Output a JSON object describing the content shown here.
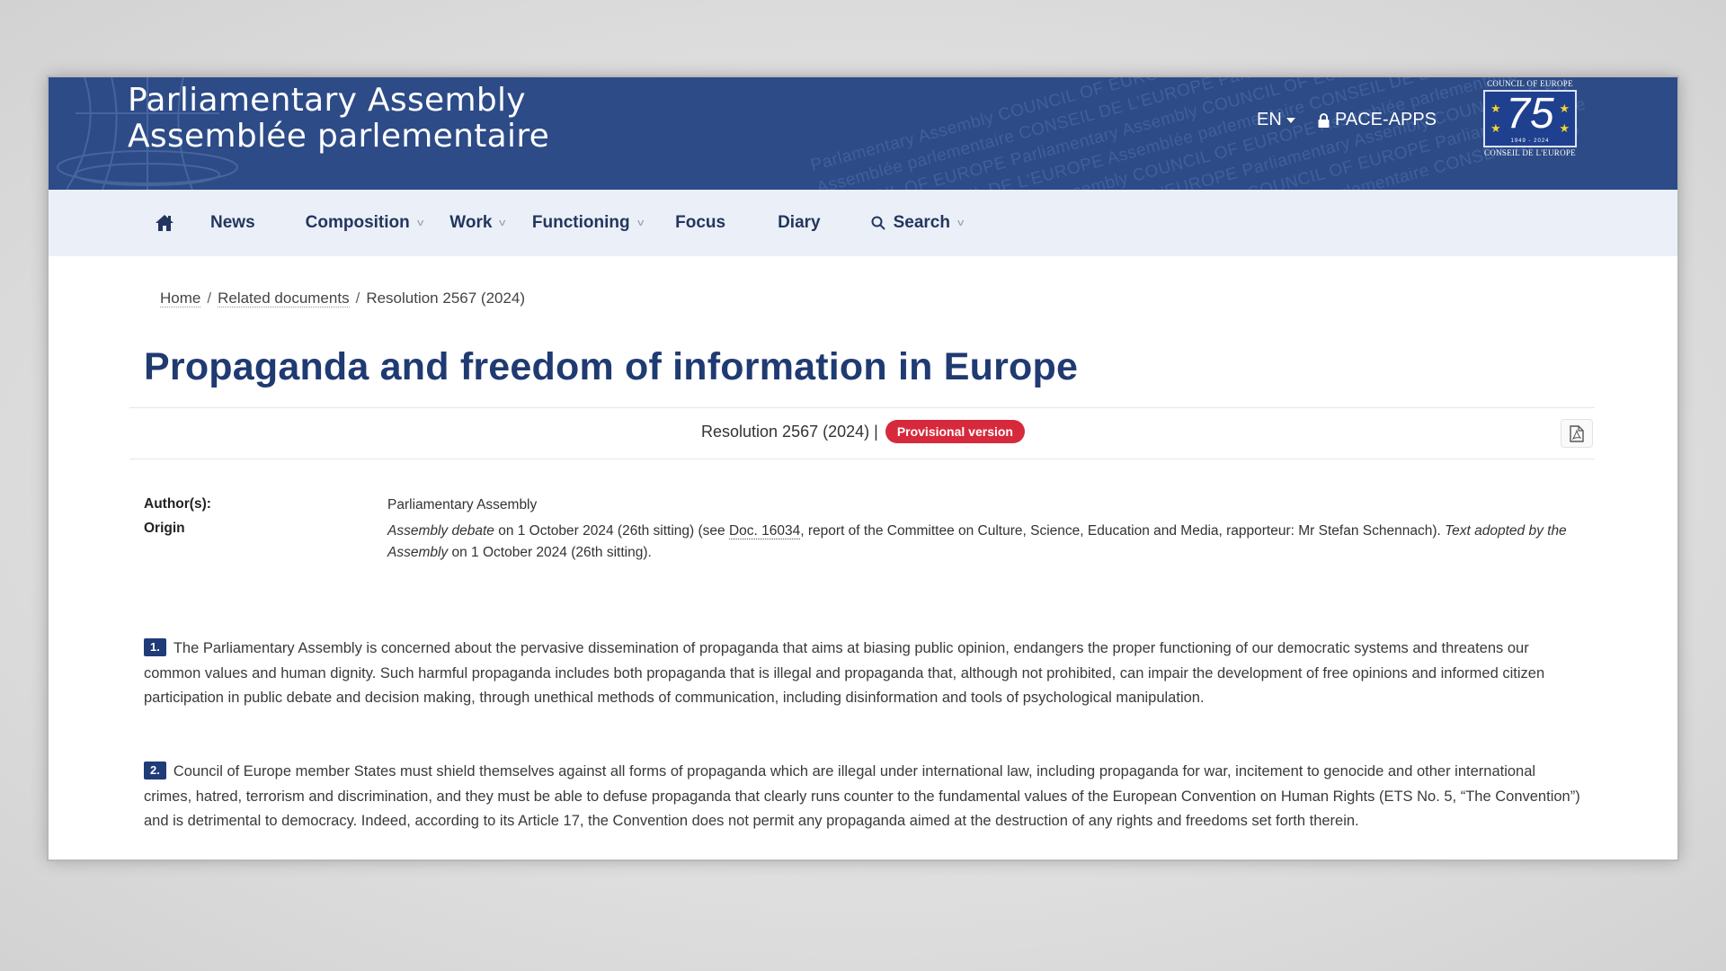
{
  "header": {
    "brand_line1": "Parliamentary Assembly",
    "brand_line2": "Assemblée parlementaire",
    "language": "EN",
    "apps_label": "PACE-APPS",
    "logo": {
      "top_text": "COUNCIL OF EUROPE",
      "number": "75",
      "years": "1949 - 2024",
      "bottom_text": "CONSEIL DE L'EUROPE"
    },
    "watermark_lines": [
      "Parlamentary Assembly   COUNCIL OF EUROPE   Assemblée parlementaire   CONSEIL DE L'EUROPE",
      "Assemblée parlementaire   CONSEIL DE L'EUROPE   Parliamentary Assembly   COUNCIL OF EUROPE",
      "COUNCIL OF EUROPE   Parliamentary Assembly   COUNCIL OF EUROPE   Assemblée parlementaire",
      "Assembly   CONSEIL DE L'EUROPE   Assemblée parlementaire   CONSEIL DE L'EUROPE   Parlia",
      "OF EUROPE   Parliamentary Assembly   COUNCIL OF EUROPE   Assemblée parlementaire   CON",
      "Assemblée parlementaire   CONSEIL DE L'EUROPE   Parliamentary Assembly   COUNCIL OF EU",
      "CONSEIL DE L'EUROPE   Assemblée parlementaire   COUNCIL OF EUROPE   Parliamentary Asse",
      "Parliamentary Assembly   COUNCIL OF EUROPE   Assemblée parlementaire   CONSEIL DE L'EU"
    ]
  },
  "nav": {
    "items": [
      {
        "label": "News",
        "dropdown": false
      },
      {
        "label": "Composition",
        "dropdown": true
      },
      {
        "label": "Work",
        "dropdown": true
      },
      {
        "label": "Functioning",
        "dropdown": true
      },
      {
        "label": "Focus",
        "dropdown": false
      },
      {
        "label": "Diary",
        "dropdown": false
      },
      {
        "label": "Search",
        "dropdown": true
      }
    ]
  },
  "breadcrumb": {
    "home": "Home",
    "related": "Related documents",
    "current": "Resolution 2567 (2024)",
    "separator": "/"
  },
  "document": {
    "title": "Propaganda and freedom of information in Europe",
    "reference": "Resolution 2567 (2024) |",
    "badge": "Provisional version",
    "badge_color": "#d62a3c",
    "pdf_icon": "pdf-file-icon"
  },
  "meta": {
    "author_label": "Author(s):",
    "author_value": "Parliamentary Assembly",
    "origin_label": "Origin",
    "origin_italic1": "Assembly debate",
    "origin_text1": " on 1 October 2024 (26th sitting) (see ",
    "origin_link": "Doc. 16034",
    "origin_text2": ", report of the Committee on Culture, Science, Education and Media, rapporteur: Mr Stefan Schennach). ",
    "origin_italic2": "Text adopted by the Assembly",
    "origin_text3": " on 1 October 2024 (26th sitting)."
  },
  "paragraphs": [
    {
      "number": "1.",
      "text": "The Parliamentary Assembly is concerned about the pervasive dissemination of propaganda that aims at biasing public opinion, endangers the proper functioning of our democratic systems and threatens our common values and human dignity. Such harmful propaganda includes both propaganda that is illegal and propaganda that, although not prohibited, can impair the development of free opinions and informed citizen participation in public debate and decision making, through unethical methods of communication, including disinformation and tools of psychological manipulation."
    },
    {
      "number": "2.",
      "text": "Council of Europe member States must shield themselves against all forms of propaganda which are illegal under international law, including propaganda for war, incitement to genocide and other international crimes, hatred, terrorism and discrimination, and they must be able to defuse propaganda that clearly runs counter to the fundamental values of the European Convention on Human Rights (ETS No. 5, “The Convention”) and is detrimental to democracy. Indeed, according to its Article 17, the Convention does not permit any propaganda aimed at the destruction of any rights and freedoms set forth therein."
    }
  ],
  "colors": {
    "header_bg": "#2c4b87",
    "nav_bg": "#ebf0f8",
    "title": "#203a72",
    "paragraph_number_bg": "#1f3b78"
  }
}
